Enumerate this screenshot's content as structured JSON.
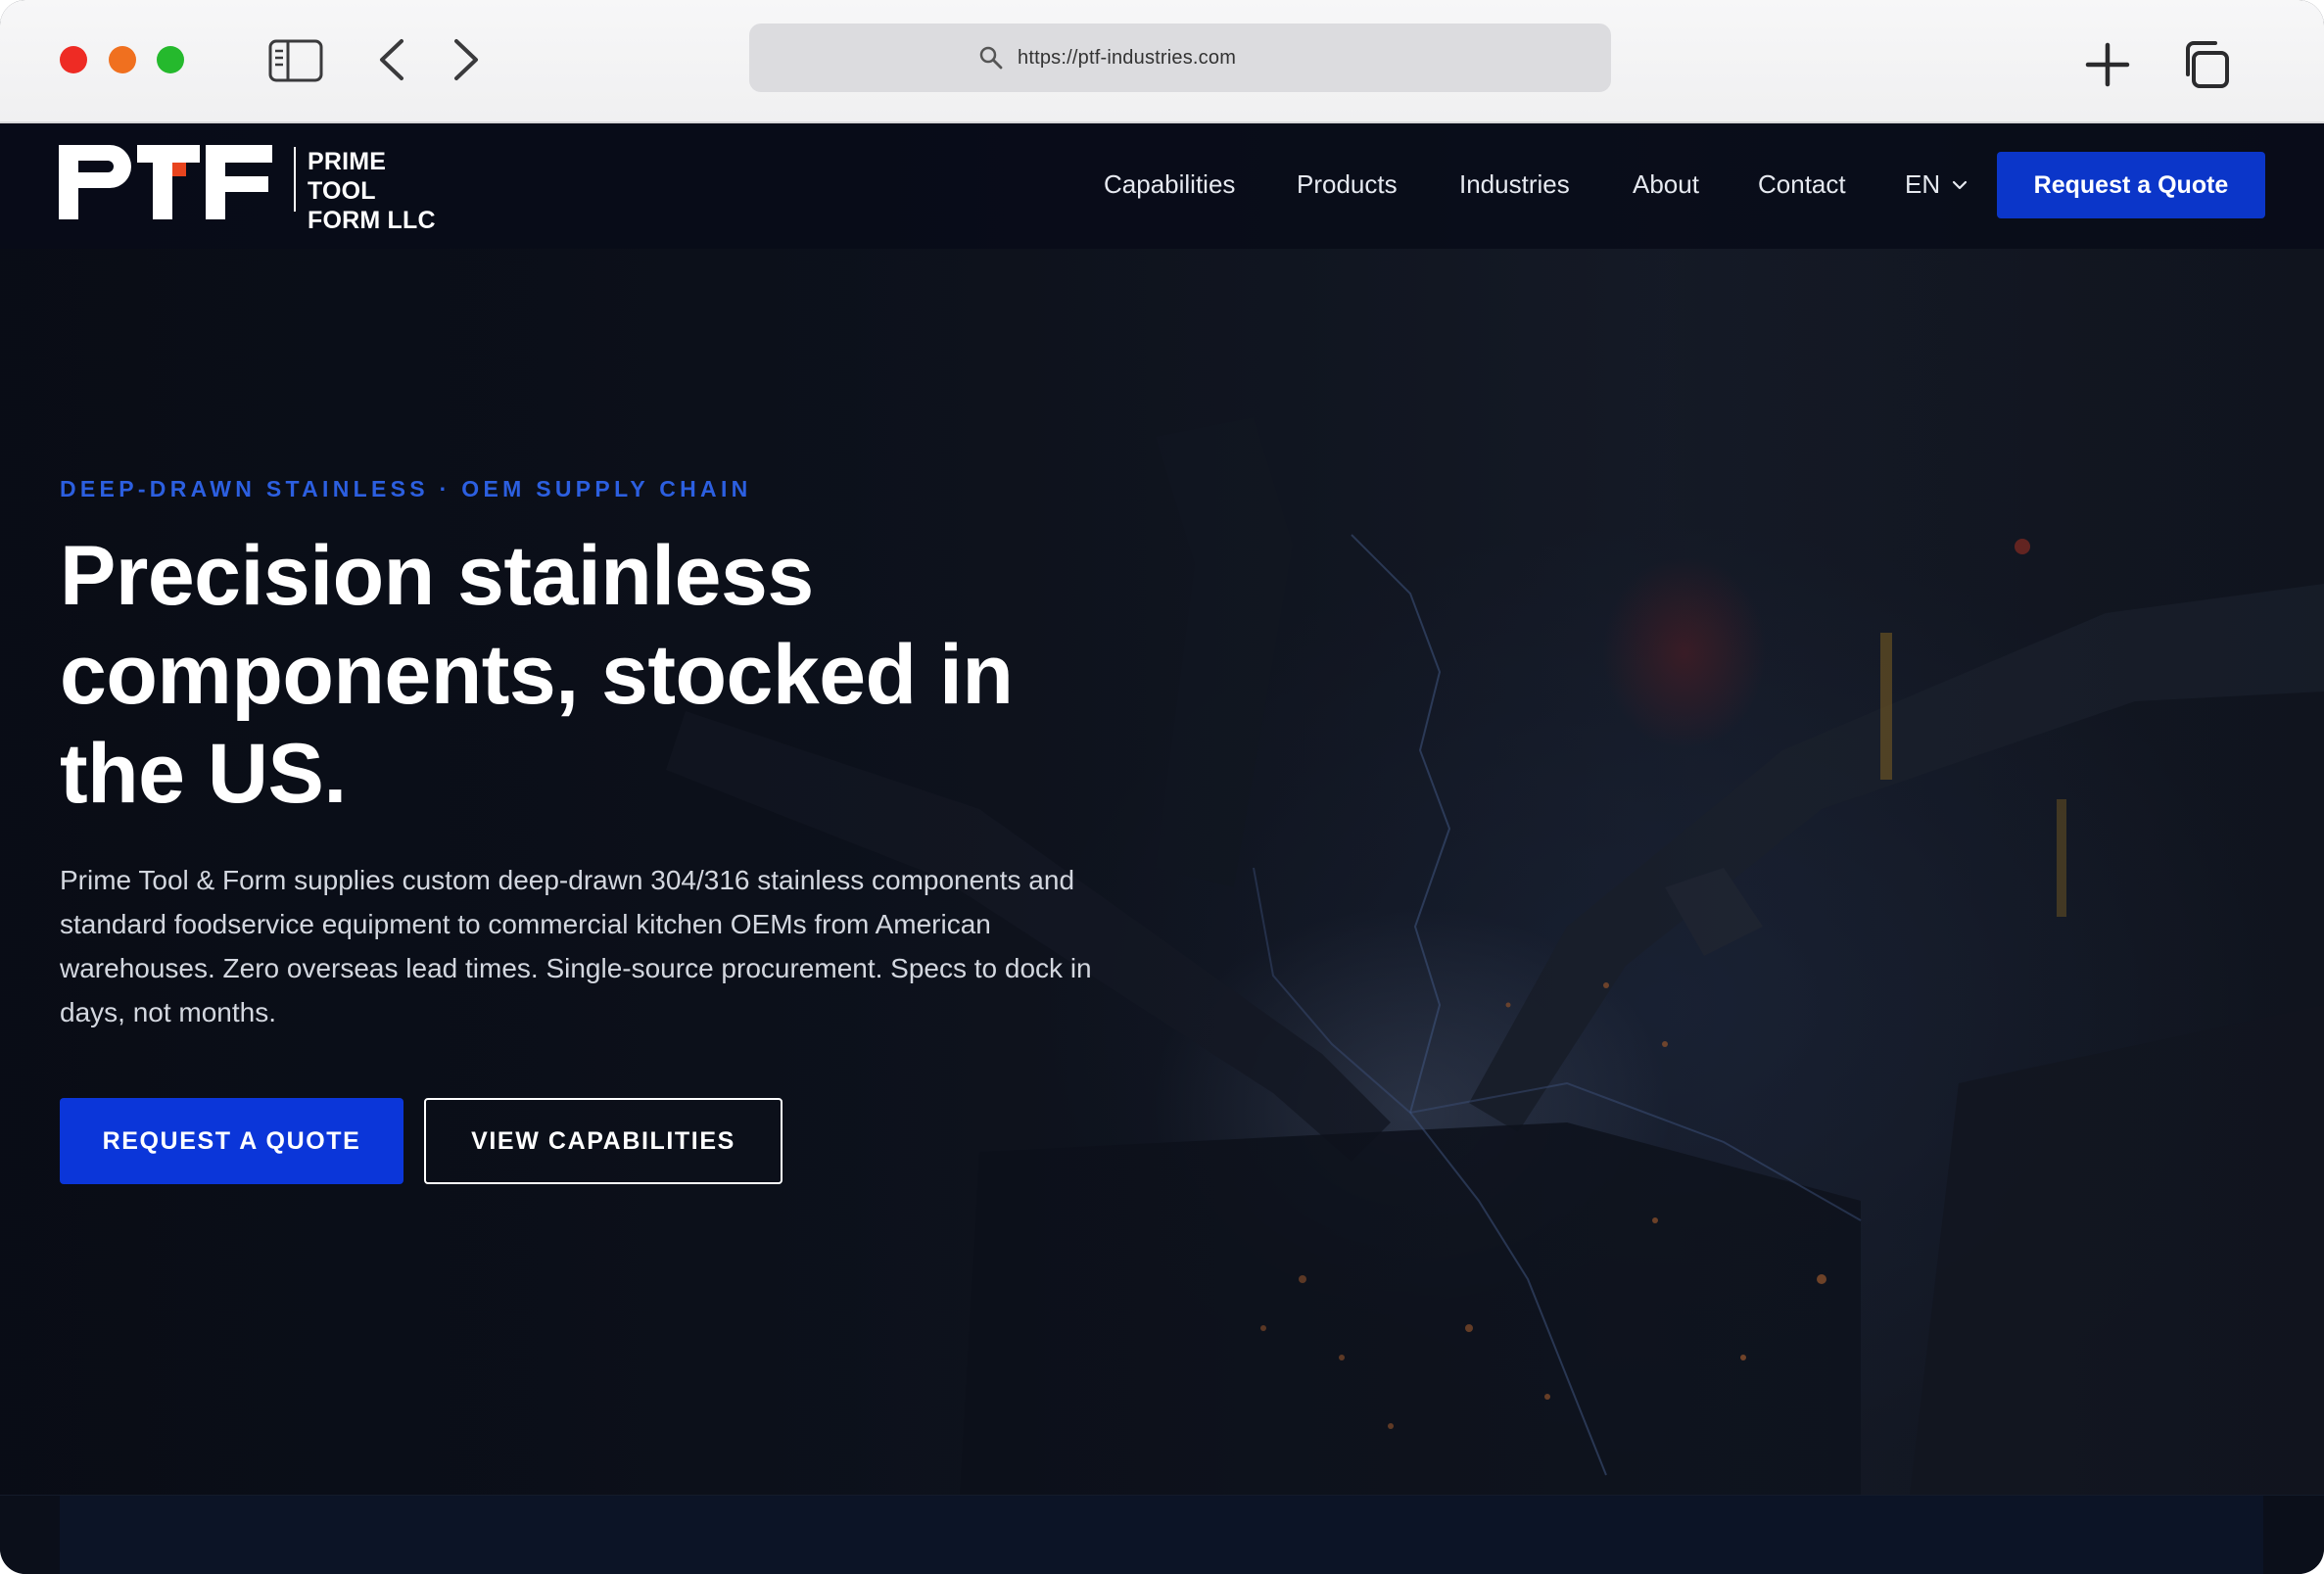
{
  "browser": {
    "url": "https://ptf-industries.com"
  },
  "header": {
    "logo_mark": "PTF",
    "logo_line1": "PRIME TOOL",
    "logo_line2": "FORM LLC",
    "nav": [
      "Capabilities",
      "Products",
      "Industries",
      "About",
      "Contact"
    ],
    "language": "EN",
    "quote_button": "Request a Quote"
  },
  "hero": {
    "eyebrow": "DEEP-DRAWN STAINLESS · OEM SUPPLY CHAIN",
    "title": "Precision stainless components, stocked in the US.",
    "description": "Prime Tool & Form supplies custom deep-drawn 304/316 stainless components and standard foodservice equipment to commercial kitchen OEMs from American warehouses. Zero overseas lead times. Single-source procurement. Specs to dock in days, not months.",
    "primary_cta": "REQUEST A QUOTE",
    "secondary_cta": "VIEW CAPABILITIES"
  },
  "colors": {
    "accent": "#0b36d9",
    "eyebrow": "#2c5fe0",
    "logo_accent": "#e8441e"
  }
}
